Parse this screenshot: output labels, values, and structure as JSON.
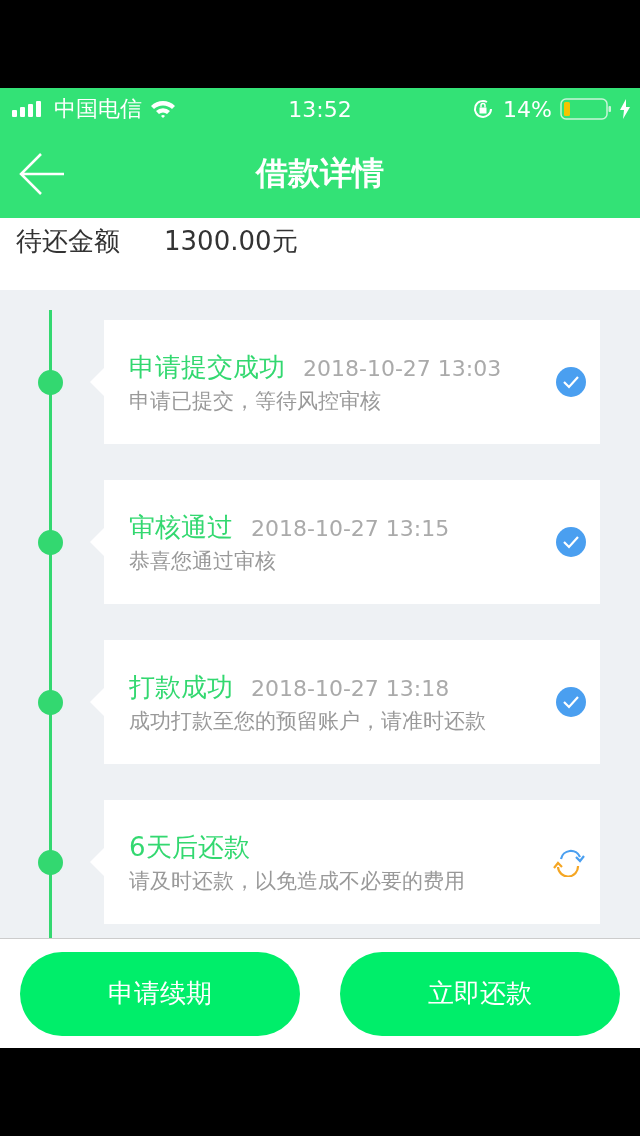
{
  "status_bar": {
    "carrier": "中国电信",
    "time": "13:52",
    "battery": "14%"
  },
  "nav": {
    "title": "借款详情"
  },
  "amount": {
    "label": "待还金额",
    "value": "1300.00元"
  },
  "steps": [
    {
      "title": "申请提交成功",
      "time": "2018-10-27 13:03",
      "desc": "申请已提交，等待风控审核",
      "kind": "done"
    },
    {
      "title": "审核通过",
      "time": "2018-10-27 13:15",
      "desc": "恭喜您通过审核",
      "kind": "done"
    },
    {
      "title": "打款成功",
      "time": "2018-10-27 13:18",
      "desc": "成功打款至您的预留账户，请准时还款",
      "kind": "done"
    },
    {
      "title": "6天后还款",
      "desc": "请及时还款，以免造成不必要的费用",
      "kind": "pending"
    }
  ],
  "buttons": [
    "申请续期",
    "立即还款"
  ]
}
